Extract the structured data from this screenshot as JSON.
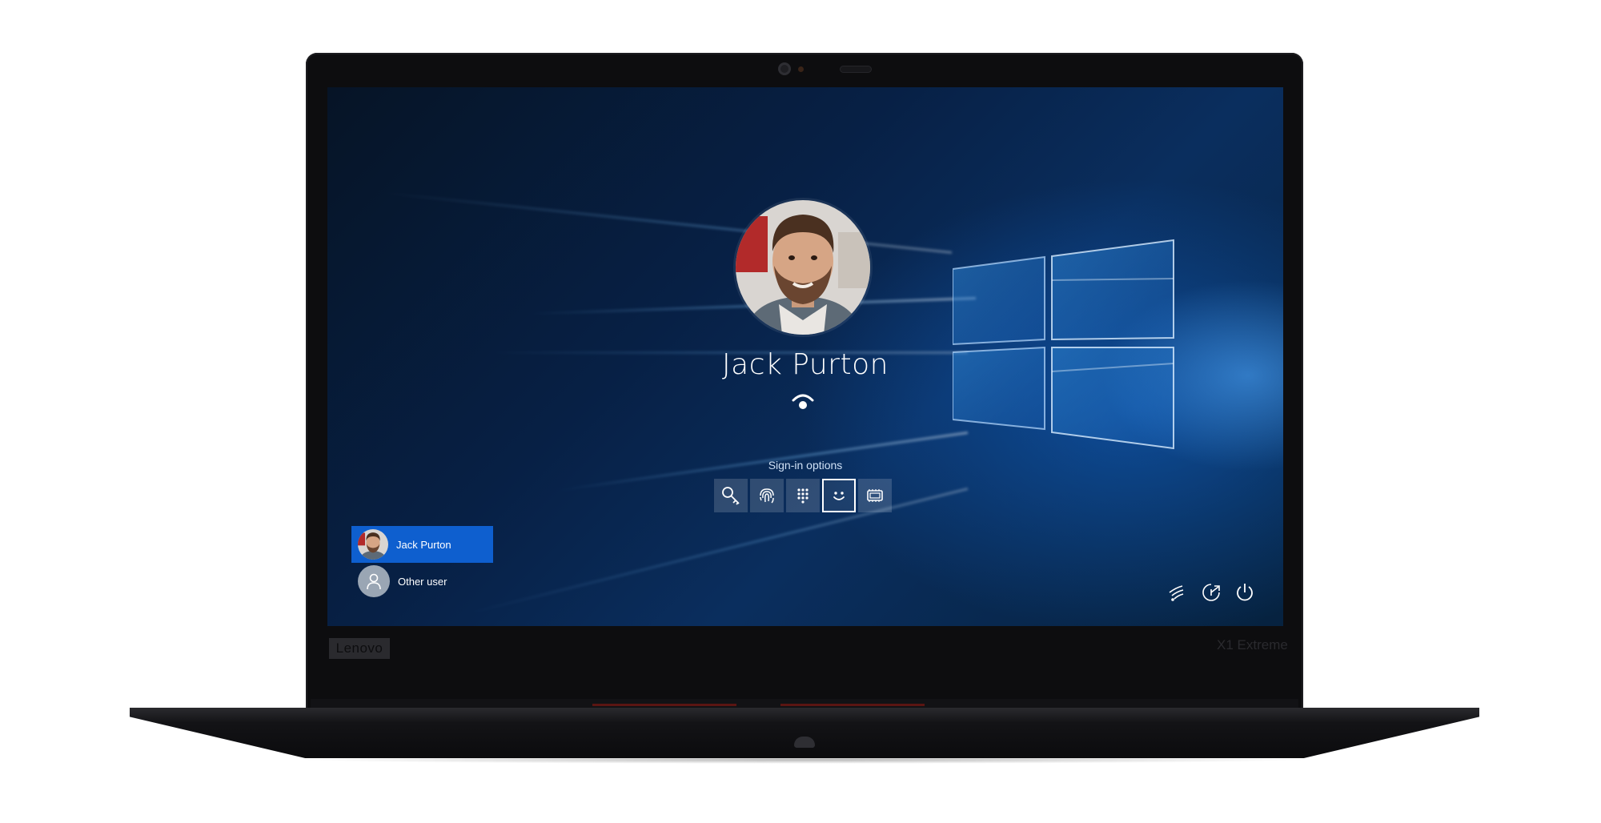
{
  "lock_screen": {
    "user_name": "Jack Purton",
    "signin_options_label": "Sign-in options",
    "signin_options": [
      {
        "icon": "key-icon",
        "selected": false
      },
      {
        "icon": "fingerprint-icon",
        "selected": false
      },
      {
        "icon": "pin-keypad-icon",
        "selected": false
      },
      {
        "icon": "face-icon",
        "selected": true
      },
      {
        "icon": "security-key-icon",
        "selected": false
      }
    ],
    "status_icon": "face-recognition-icon"
  },
  "user_list": {
    "items": [
      {
        "label": "Jack Purton",
        "active": true
      },
      {
        "label": "Other user",
        "active": false
      }
    ]
  },
  "system_icons": [
    "network-icon",
    "ease-of-access-icon",
    "power-icon"
  ],
  "device": {
    "brand": "Lenovo",
    "model": "X1 Extreme"
  },
  "colors": {
    "active_user_bg": "#0e5fcf",
    "wallpaper_blue": "#0a2e5e",
    "bezel": "#0d0d0f"
  }
}
